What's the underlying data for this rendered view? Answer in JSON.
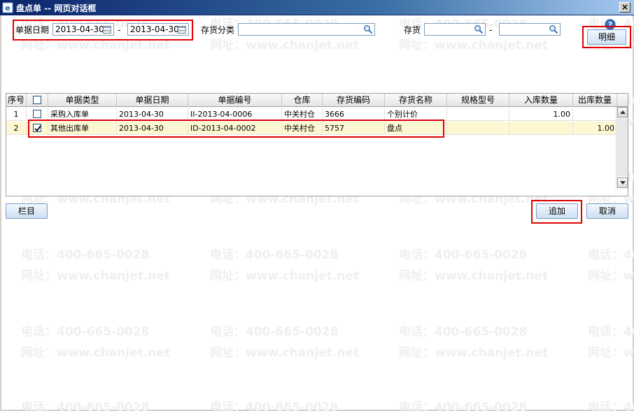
{
  "window": {
    "title": "盘点单 -- 网页对话框",
    "close_glyph": "×"
  },
  "watermark": {
    "phone": "电话：400-665-0028",
    "site": "网址：www.chanjet.net"
  },
  "filters": {
    "date_label": "单据日期",
    "date_from": "2013-04-30",
    "date_sep": "-",
    "date_to": "2013-04-30",
    "category_label": "存货分类",
    "category_value": "",
    "stock_label": "存货",
    "stock_from": "",
    "stock_sep": "-",
    "stock_to": ""
  },
  "toolbar": {
    "detail_label": "明细",
    "help_glyph": "?",
    "columns_label": "栏目",
    "add_label": "追加",
    "cancel_label": "取消"
  },
  "grid": {
    "headers": [
      "序号",
      "",
      "单据类型",
      "单据日期",
      "单据编号",
      "仓库",
      "存货编码",
      "存货名称",
      "规格型号",
      "入库数量",
      "出库数量"
    ],
    "rows": [
      {
        "seq": "1",
        "checked": false,
        "type": "采购入库单",
        "date": "2013-04-30",
        "code": "II-2013-04-0006",
        "warehouse": "中关村仓",
        "item_code": "3666",
        "item_name": "个别计价",
        "spec": "",
        "in_qty": "1.00",
        "out_qty": ""
      },
      {
        "seq": "2",
        "checked": true,
        "type": "其他出库单",
        "date": "2013-04-30",
        "code": "ID-2013-04-0002",
        "warehouse": "中关村仓",
        "item_code": "5757",
        "item_name": "盘点",
        "spec": "",
        "in_qty": "",
        "out_qty": "1.00"
      }
    ]
  },
  "colors": {
    "highlight": "#e00000",
    "selected_row": "#fdf7d2",
    "title_start": "#0a246a"
  }
}
